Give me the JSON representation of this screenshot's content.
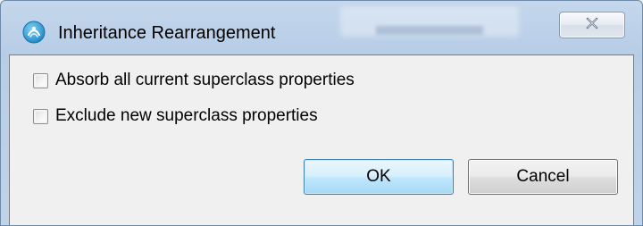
{
  "window": {
    "title": "Inheritance Rearrangement",
    "icon": "app-icon",
    "close_icon": "close-icon"
  },
  "options": [
    {
      "label": "Absorb all current superclass properties",
      "checked": false
    },
    {
      "label": "Exclude new superclass properties",
      "checked": false
    }
  ],
  "buttons": {
    "ok_label": "OK",
    "cancel_label": "Cancel"
  },
  "colors": {
    "titlebar": "#bcd1e9",
    "ok_border": "#3c7fb1",
    "client_bg": "#f0f0f0"
  }
}
